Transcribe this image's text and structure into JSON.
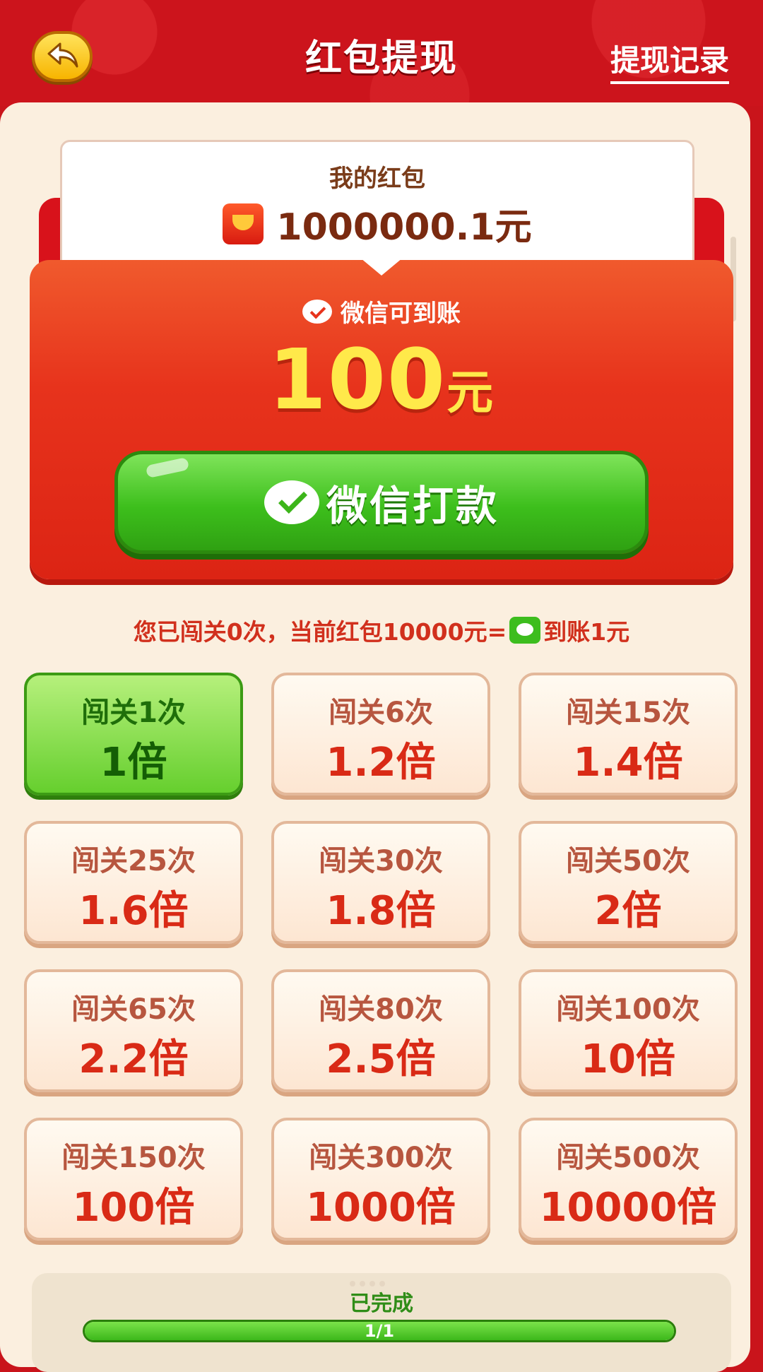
{
  "header": {
    "title": "红包提现",
    "history_label": "提现记录"
  },
  "wallet": {
    "label": "我的红包",
    "amount": "1000000.1元"
  },
  "withdraw": {
    "arrive_label": "微信可到账",
    "amount": "100",
    "unit": "元",
    "pay_button": "微信打款"
  },
  "info": {
    "prefix": "您已闯关0次，当前红包10000元=",
    "suffix": "到账1元"
  },
  "tiers": [
    {
      "levels": "闯关1次",
      "mult": "1倍",
      "active": true
    },
    {
      "levels": "闯关6次",
      "mult": "1.2倍"
    },
    {
      "levels": "闯关15次",
      "mult": "1.4倍"
    },
    {
      "levels": "闯关25次",
      "mult": "1.6倍"
    },
    {
      "levels": "闯关30次",
      "mult": "1.8倍"
    },
    {
      "levels": "闯关50次",
      "mult": "2倍"
    },
    {
      "levels": "闯关65次",
      "mult": "2.2倍"
    },
    {
      "levels": "闯关80次",
      "mult": "2.5倍"
    },
    {
      "levels": "闯关100次",
      "mult": "10倍"
    },
    {
      "levels": "闯关150次",
      "mult": "100倍"
    },
    {
      "levels": "闯关300次",
      "mult": "1000倍"
    },
    {
      "levels": "闯关500次",
      "mult": "10000倍"
    }
  ],
  "progress": {
    "label": "已完成",
    "text": "1/1",
    "fraction": 1.0
  },
  "colors": {
    "brand_red": "#cc141c",
    "accent_green": "#3dbf1c",
    "amount_yellow": "#ffe94a"
  }
}
